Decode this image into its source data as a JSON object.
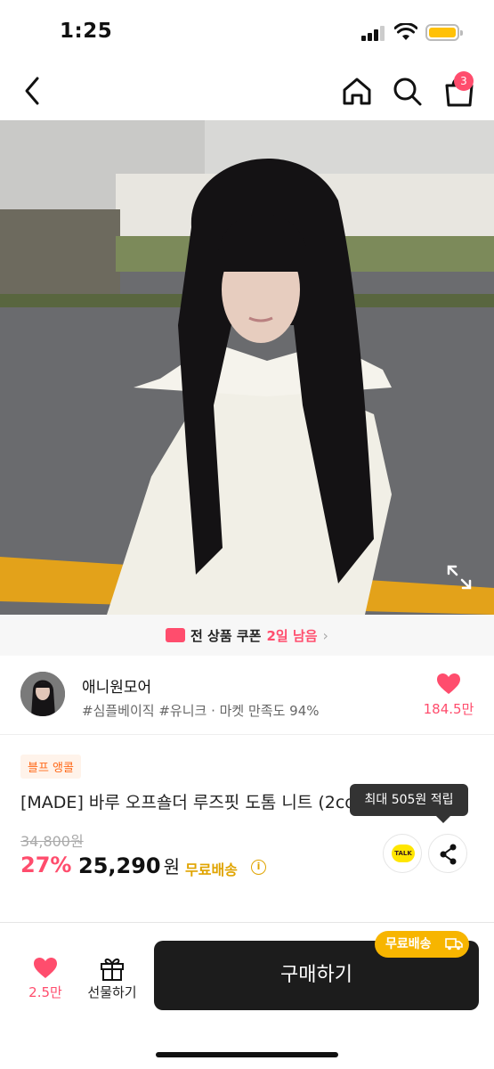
{
  "status": {
    "time": "1:25"
  },
  "nav": {
    "cart_count": "3"
  },
  "coupon": {
    "text": "전 상품 쿠폰",
    "days_left": "2일 남음",
    "chevron": "›"
  },
  "store": {
    "name": "애니원모어",
    "tags": "#심플베이직 #유니크 · 마켓 만족도 94%",
    "favorite_count": "184.5만"
  },
  "product": {
    "badge": "블프 앵콜",
    "title": "[MADE] 바루 오프숄더 루즈핏 도톰 니트 (2color)",
    "original_price": "34,800원",
    "discount": "27%",
    "price": "25,290",
    "price_unit": "원",
    "shipping": "무료배송",
    "points_tooltip": "최대 505원 적립",
    "talk_label": "TALK"
  },
  "bottom": {
    "like_count": "2.5만",
    "gift_label": "선물하기",
    "buy_label": "구매하기",
    "shipping_pill": "무료배송"
  },
  "colors": {
    "accent": "#ff4d6d",
    "shipping": "#f7b500",
    "buy_button": "#1c1c1c"
  },
  "icons": [
    "back-icon",
    "home-icon",
    "search-icon",
    "cart-icon",
    "expand-icon",
    "coupon-icon",
    "heart-icon",
    "info-icon",
    "talk-icon",
    "share-icon",
    "gift-icon",
    "truck-icon"
  ]
}
